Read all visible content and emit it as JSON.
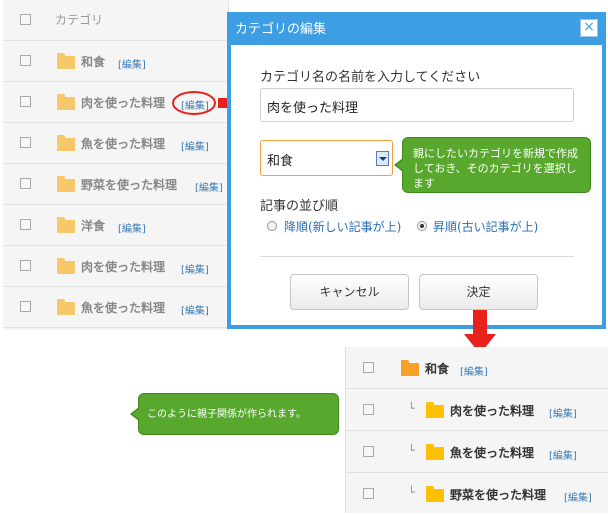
{
  "list": {
    "header": "カテゴリ",
    "edit_label": "[編集]",
    "rows": [
      "和食",
      "肉を使った料理",
      "魚を使った料理",
      "野菜を使った料理",
      "洋食",
      "肉を使った料理",
      "魚を使った料理"
    ]
  },
  "dialog": {
    "title": "カテゴリの編集",
    "close_glyph": "×",
    "name_label": "カテゴリ名の名前を入力してください",
    "name_value": "肉を使った料理",
    "parent_value": "和食",
    "order_label": "記事の並び順",
    "order_desc": "降順(新しい記事が上)",
    "order_asc": "昇順(古い記事が上)",
    "order_selected": "asc",
    "cancel_label": "キャンセル",
    "ok_label": "決定"
  },
  "callouts": {
    "parent_hint": "親にしたいカテゴリを新規で作成しておき、そのカテゴリを選択します",
    "result_hint": "このように親子関係が作られます。"
  },
  "result": {
    "edit_label": "[編集]",
    "tree_glyph": "└",
    "parent": "和食",
    "children": [
      "肉を使った料理",
      "魚を使った料理",
      "野菜を使った料理"
    ]
  },
  "colors": {
    "dialog_border": "#3d9ee4",
    "callout_green": "#57a82c",
    "arrow_red": "#e8211c",
    "link_blue": "#3b7bb5"
  }
}
